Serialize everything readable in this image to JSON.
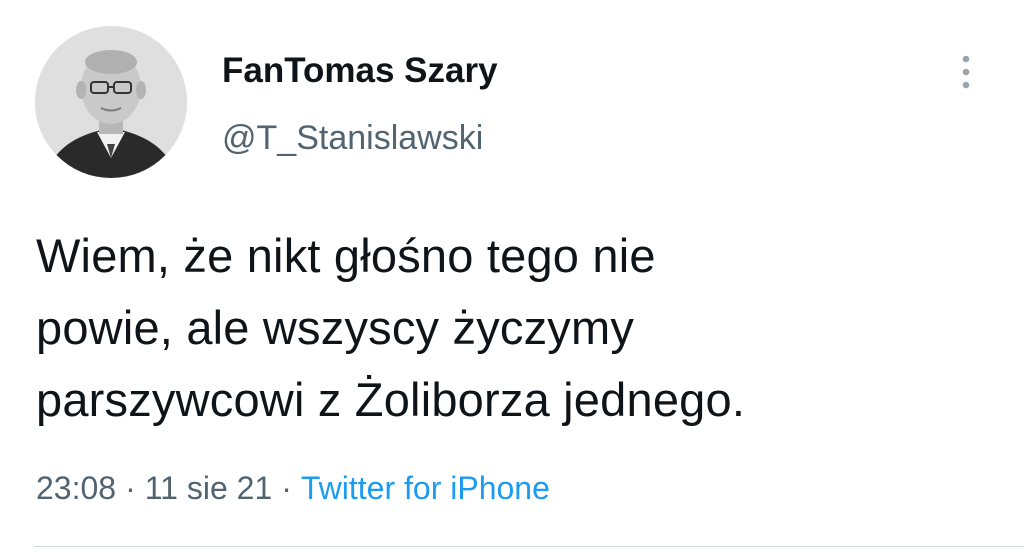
{
  "author": {
    "display_name": "FanTomas Szary",
    "handle": "@T_Stanislawski",
    "avatar_icon": "profile-photo"
  },
  "tweet": {
    "text_lines": [
      "Wiem, że nikt głośno tego nie",
      "powie, ale wszyscy życzymy",
      "parszywcowi z Żoliborza jednego."
    ],
    "time": "23:08",
    "date": "11 sie 21",
    "separator": "·",
    "source": "Twitter for iPhone"
  },
  "menu": {
    "icon": "more-vertical-icon"
  },
  "colors": {
    "text": "#0f1419",
    "secondary": "#536471",
    "link": "#1d9bf0",
    "divider": "#cfd9de"
  }
}
